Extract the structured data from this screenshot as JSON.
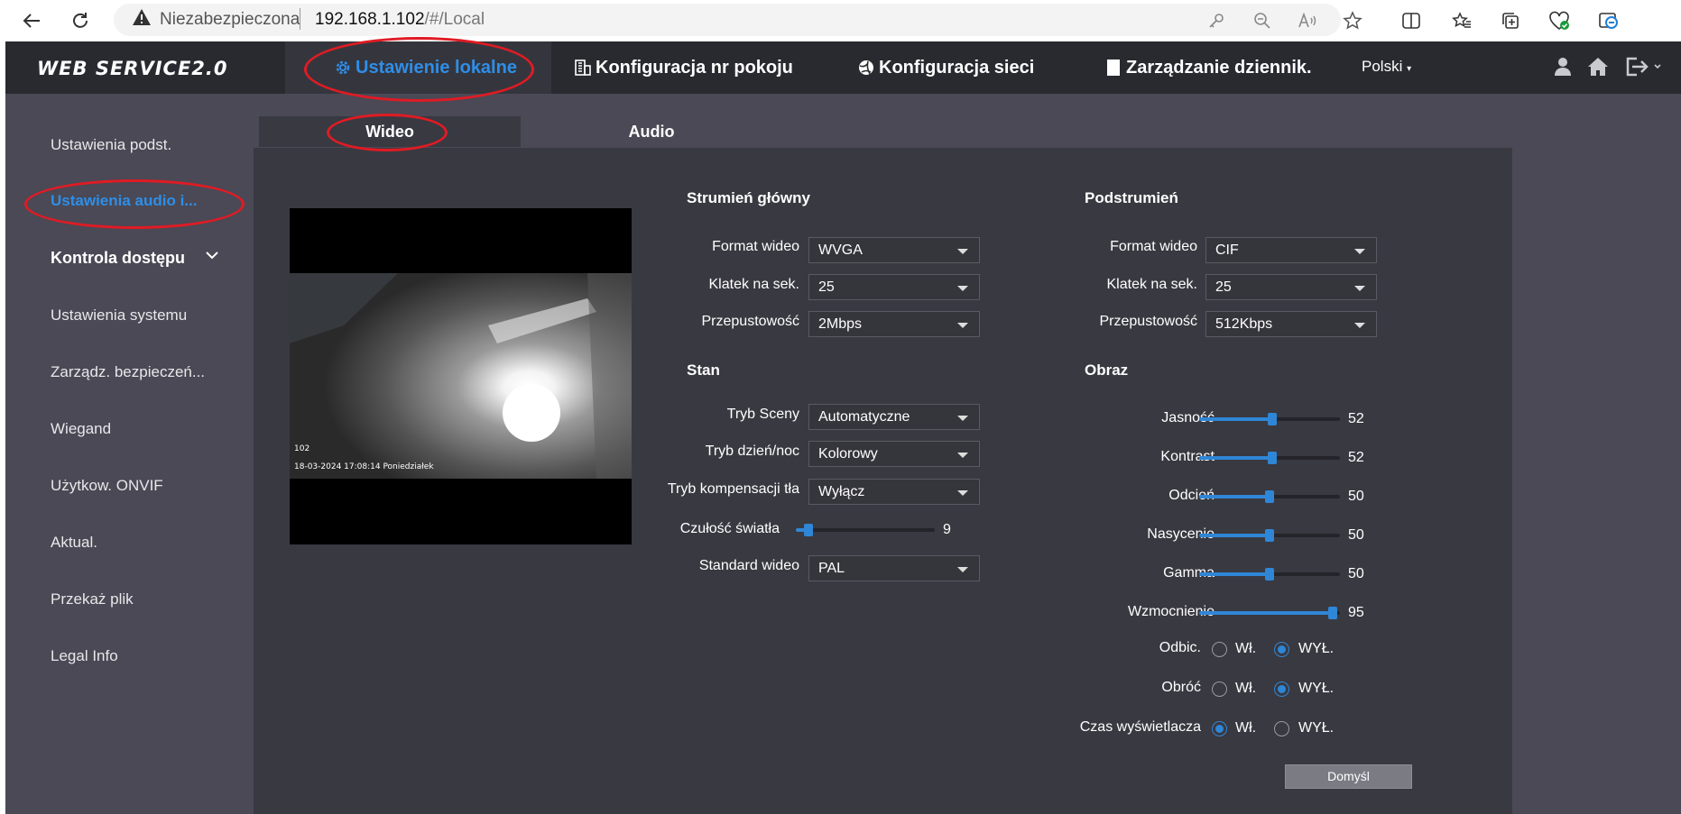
{
  "browser": {
    "security_label": "Niezabezpieczona",
    "url_host": "192.168.1.102",
    "url_path": "/#/Local"
  },
  "topbar": {
    "logo": "WEB SERVICE2.0",
    "nav": [
      {
        "label": "Ustawienie lokalne",
        "icon": "gear-icon"
      },
      {
        "label": "Konfiguracja nr pokoju",
        "icon": "building-icon"
      },
      {
        "label": "Konfiguracja sieci",
        "icon": "globe-icon"
      },
      {
        "label": "Zarządzanie dziennik.",
        "icon": "log-icon"
      }
    ],
    "language": "Polski"
  },
  "sidebar": {
    "items": [
      {
        "label": "Ustawienia podst."
      },
      {
        "label": "Ustawienia audio i..."
      },
      {
        "label": "Kontrola dostępu"
      },
      {
        "label": "Ustawienia systemu"
      },
      {
        "label": "Zarządz. bezpieczeń..."
      },
      {
        "label": "Wiegand"
      },
      {
        "label": "Użytkow. ONVIF"
      },
      {
        "label": "Aktual."
      },
      {
        "label": "Przekaż plik"
      },
      {
        "label": "Legal Info"
      }
    ]
  },
  "tabs": [
    {
      "label": "Wideo"
    },
    {
      "label": "Audio"
    }
  ],
  "preview": {
    "channel": "102",
    "timestamp": "18-03-2024 17:08:14 Poniedziałek"
  },
  "main_stream": {
    "title": "Strumień główny",
    "fields": [
      {
        "label": "Format wideo",
        "value": "WVGA"
      },
      {
        "label": "Klatek na sek.",
        "value": "25"
      },
      {
        "label": "Przepustowość",
        "value": "2Mbps"
      }
    ]
  },
  "sub_stream": {
    "title": "Podstrumień",
    "fields": [
      {
        "label": "Format wideo",
        "value": "CIF"
      },
      {
        "label": "Klatek na sek.",
        "value": "25"
      },
      {
        "label": "Przepustowość",
        "value": "512Kbps"
      }
    ]
  },
  "status": {
    "title": "Stan",
    "fields": [
      {
        "label": "Tryb Sceny",
        "value": "Automatyczne"
      },
      {
        "label": "Tryb dzień/noc",
        "value": "Kolorowy"
      },
      {
        "label": "Tryb kompensacji tła",
        "value": "Wyłącz"
      }
    ],
    "sensitivity": {
      "label": "Czułość światła",
      "value": "9",
      "fraction": 0.09
    },
    "standard": {
      "label": "Standard wideo",
      "value": "PAL"
    }
  },
  "image": {
    "title": "Obraz",
    "sliders": [
      {
        "label": "Jasność",
        "value": "52",
        "fraction": 0.52
      },
      {
        "label": "Kontrast",
        "value": "52",
        "fraction": 0.52
      },
      {
        "label": "Odcień",
        "value": "50",
        "fraction": 0.5
      },
      {
        "label": "Nasycenie",
        "value": "50",
        "fraction": 0.5
      },
      {
        "label": "Gamma",
        "value": "50",
        "fraction": 0.5
      },
      {
        "label": "Wzmocnienie",
        "value": "95",
        "fraction": 0.95
      }
    ],
    "radios": [
      {
        "label": "Odbic.",
        "on_label": "Wł.",
        "off_label": "WYŁ.",
        "selected": "off"
      },
      {
        "label": "Obróć",
        "on_label": "Wł.",
        "off_label": "WYŁ.",
        "selected": "off"
      },
      {
        "label": "Czas wyświetlacza",
        "on_label": "Wł.",
        "off_label": "WYŁ.",
        "selected": "on"
      }
    ],
    "default_button": "Domyśl"
  },
  "colors": {
    "accent": "#2e8ee8",
    "annotation": "#e01b24"
  }
}
